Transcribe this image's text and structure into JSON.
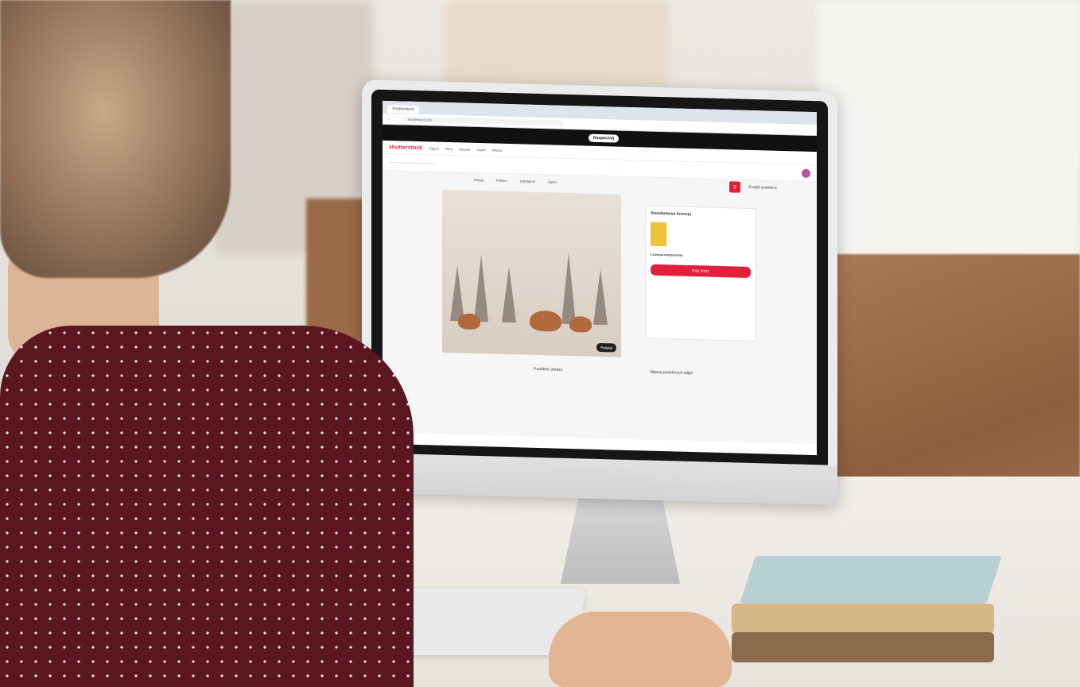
{
  "browser": {
    "tab_title": "Shutterstock",
    "url": "shutterstock.com"
  },
  "banner": {
    "text": "",
    "button_label": "Rozpocznij"
  },
  "site": {
    "logo": "shutterstock",
    "nav_items": [
      "Zdjęcia",
      "Filmy",
      "Muzyka",
      "Edytor",
      "Więcej"
    ],
    "search_placeholder": "",
    "find_label": "Znajdź podobne"
  },
  "actions": [
    "Edycja",
    "Pobierz",
    "Udostępnij",
    "Zapisz"
  ],
  "image": {
    "preview_label": "Podgląd"
  },
  "purchase_card": {
    "plan_title": "Standardowa licencja",
    "price": "",
    "license_label": "Licencja rozszerzona",
    "buy_label": "Kup teraz"
  },
  "sections": [
    "Podobne obrazy",
    "Więcej podobnych zdjęć"
  ],
  "colors": {
    "brand": "#e2203b",
    "shirt": "#5a1720"
  }
}
